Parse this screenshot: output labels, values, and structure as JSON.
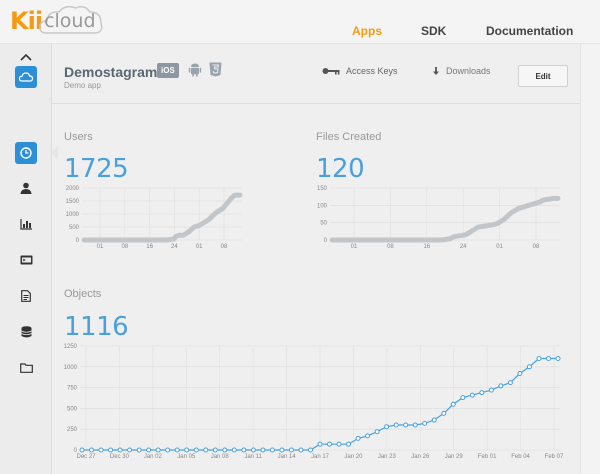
{
  "brand": {
    "kii": "Kii",
    "cloud": "cloud"
  },
  "nav": {
    "apps": "Apps",
    "sdk": "SDK",
    "documentation": "Documentation"
  },
  "app": {
    "name": "Demostagram",
    "subtitle": "Demo app",
    "ios_badge": "iOS",
    "access_keys": "Access Keys",
    "downloads": "Downloads",
    "edit": "Edit"
  },
  "sidebar": {
    "icons": [
      "chevron-up-icon",
      "cloud-icon",
      "clock-icon",
      "user-icon",
      "bar-chart-icon",
      "console-icon",
      "document-icon",
      "database-icon",
      "folder-icon"
    ],
    "selected": [
      "cloud-icon",
      "clock-icon"
    ]
  },
  "colors": {
    "accent": "#f39c12",
    "blue": "#4aa0dc",
    "selected": "#2d8fd6",
    "sparkline": "#c3c6c9"
  },
  "stats": {
    "users": {
      "label": "Users",
      "value": "1725"
    },
    "files": {
      "label": "Files Created",
      "value": "120"
    },
    "objects": {
      "label": "Objects",
      "value": "1116"
    }
  },
  "chart_data": [
    {
      "type": "area",
      "title": "Users",
      "yticks": [
        "2000",
        "1500",
        "1000",
        "500",
        "0"
      ],
      "ytick_values": [
        2000,
        1500,
        1000,
        500,
        0
      ],
      "xticks": [
        "01",
        "08",
        "16",
        "24",
        "01",
        "08"
      ],
      "ylim": [
        0,
        2000
      ],
      "values": [
        0,
        0,
        0,
        0,
        0,
        0,
        0,
        0,
        0,
        0,
        0,
        0,
        0,
        0,
        0,
        0,
        0,
        0,
        0,
        0,
        0,
        0,
        0,
        0,
        0,
        0,
        0,
        0,
        0,
        0,
        0,
        0,
        0,
        0,
        0,
        0,
        0,
        0,
        0,
        0,
        0,
        0,
        0,
        0,
        0,
        0,
        0,
        0,
        0,
        0,
        10,
        20,
        30,
        40,
        120,
        160,
        180,
        180,
        180,
        200,
        240,
        280,
        320,
        380,
        440,
        500,
        520,
        540,
        560,
        600,
        640,
        680,
        720,
        760,
        800,
        880,
        940,
        1000,
        1060,
        1100,
        1140,
        1180,
        1220,
        1300,
        1380,
        1460,
        1540,
        1620,
        1680,
        1725,
        1725,
        1725,
        1725
      ],
      "grid": true
    },
    {
      "type": "area",
      "title": "Files Created",
      "yticks": [
        "150",
        "100",
        "50",
        "0"
      ],
      "ytick_values": [
        150,
        100,
        50,
        0
      ],
      "xticks": [
        "01",
        "08",
        "16",
        "24",
        "01",
        "08"
      ],
      "ylim": [
        0,
        150
      ],
      "values": [
        0,
        0,
        0,
        0,
        0,
        0,
        0,
        0,
        0,
        0,
        0,
        0,
        0,
        0,
        0,
        0,
        0,
        0,
        0,
        0,
        0,
        0,
        0,
        0,
        0,
        0,
        0,
        0,
        0,
        0,
        0,
        0,
        0,
        0,
        0,
        0,
        0,
        0,
        0,
        0,
        0,
        0,
        0,
        0,
        0,
        0,
        0,
        0,
        0,
        0,
        1,
        2,
        3,
        4,
        8,
        10,
        11,
        12,
        13,
        14,
        16,
        20,
        24,
        28,
        32,
        36,
        38,
        39,
        40,
        41,
        42,
        43,
        44,
        46,
        48,
        52,
        56,
        60,
        66,
        72,
        78,
        82,
        86,
        90,
        92,
        94,
        96,
        98,
        100,
        102,
        104,
        106,
        108,
        110,
        114,
        116,
        117,
        118,
        119,
        120,
        120,
        120
      ],
      "grid": true
    },
    {
      "type": "line",
      "title": "Objects",
      "yticks": [
        "1250",
        "1000",
        "750",
        "500",
        "250",
        "0"
      ],
      "ytick_values": [
        1250,
        1000,
        750,
        500,
        250,
        0
      ],
      "xticks": [
        "Dec 27",
        "Dec 30",
        "Jan 02",
        "Jan 05",
        "Jan 08",
        "Jan 11",
        "Jan 14",
        "Jan 17",
        "Jan 20",
        "Jan 23",
        "Jan 26",
        "Jan 29",
        "Feb 01",
        "Feb 04",
        "Feb 07"
      ],
      "ylim": [
        0,
        1250
      ],
      "values": [
        0,
        0,
        0,
        0,
        0,
        0,
        0,
        0,
        0,
        0,
        0,
        0,
        0,
        0,
        0,
        0,
        0,
        0,
        0,
        0,
        0,
        0,
        0,
        0,
        0,
        70,
        70,
        70,
        70,
        140,
        170,
        220,
        280,
        300,
        300,
        300,
        320,
        360,
        440,
        550,
        630,
        660,
        690,
        720,
        770,
        810,
        920,
        1000,
        1100,
        1100,
        1100
      ],
      "grid": true
    }
  ]
}
